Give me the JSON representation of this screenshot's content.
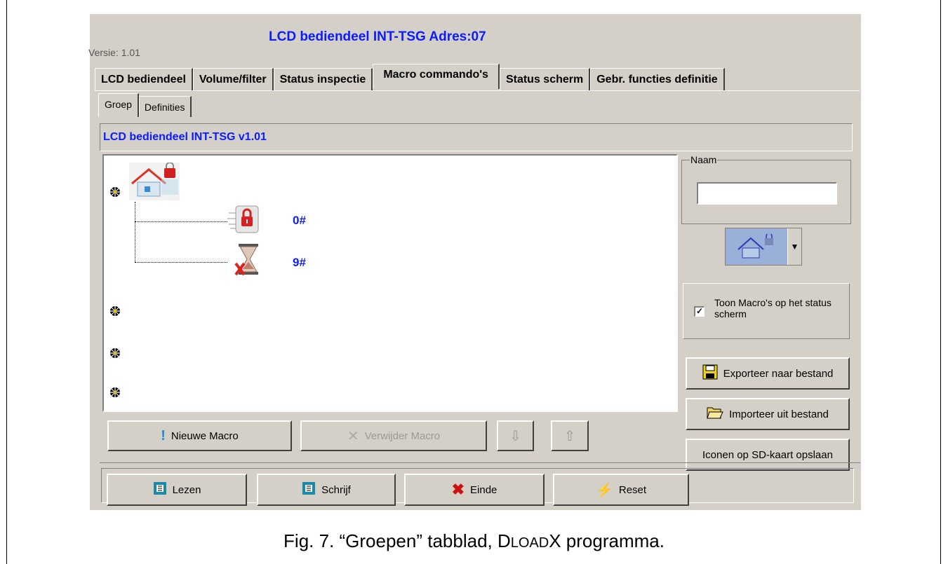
{
  "window": {
    "title": "LCD bediendeel INT-TSG Adres:07",
    "version": "Versie: 1.01"
  },
  "tabs": [
    {
      "label": "LCD bediendeel",
      "active": false
    },
    {
      "label": "Volume/filter",
      "active": false
    },
    {
      "label": "Status inspectie",
      "active": false
    },
    {
      "label": "Macro commando's",
      "active": true
    },
    {
      "label": "Status scherm",
      "active": false
    },
    {
      "label": "Gebr. functies definitie",
      "active": false
    }
  ],
  "subtabs": [
    {
      "label": "Groep",
      "active": true
    },
    {
      "label": "Definities",
      "active": false
    }
  ],
  "header": {
    "label": "LCD bediendeel INT-TSG v1.01"
  },
  "tree": {
    "macros": [
      {
        "key": "0#",
        "icon": "lock-icon"
      },
      {
        "key": "9#",
        "icon": "hourglass-cancel-icon"
      }
    ]
  },
  "buttons": {
    "new_macro": "Nieuwe Macro",
    "delete_macro": "Verwijder Macro",
    "move_down": "⇩",
    "move_up": "⇧"
  },
  "right_panel": {
    "naam_label": "Naam",
    "naam_value": "",
    "show_macros_label": "Toon Macro's op het status scherm",
    "show_macros_checked": true,
    "export_label": "Exporteer naar bestand",
    "import_label": "Importeer uit bestand",
    "save_icons_label": "Iconen op SD-kaart opslaan"
  },
  "bottom": {
    "read": "Lezen",
    "write": "Schrijf",
    "exit": "Einde",
    "reset": "Reset"
  },
  "caption": {
    "prefix": "Fig. 7. “Groepen” tabblad, D",
    "small": "LOAD",
    "suffix": "X programma."
  }
}
